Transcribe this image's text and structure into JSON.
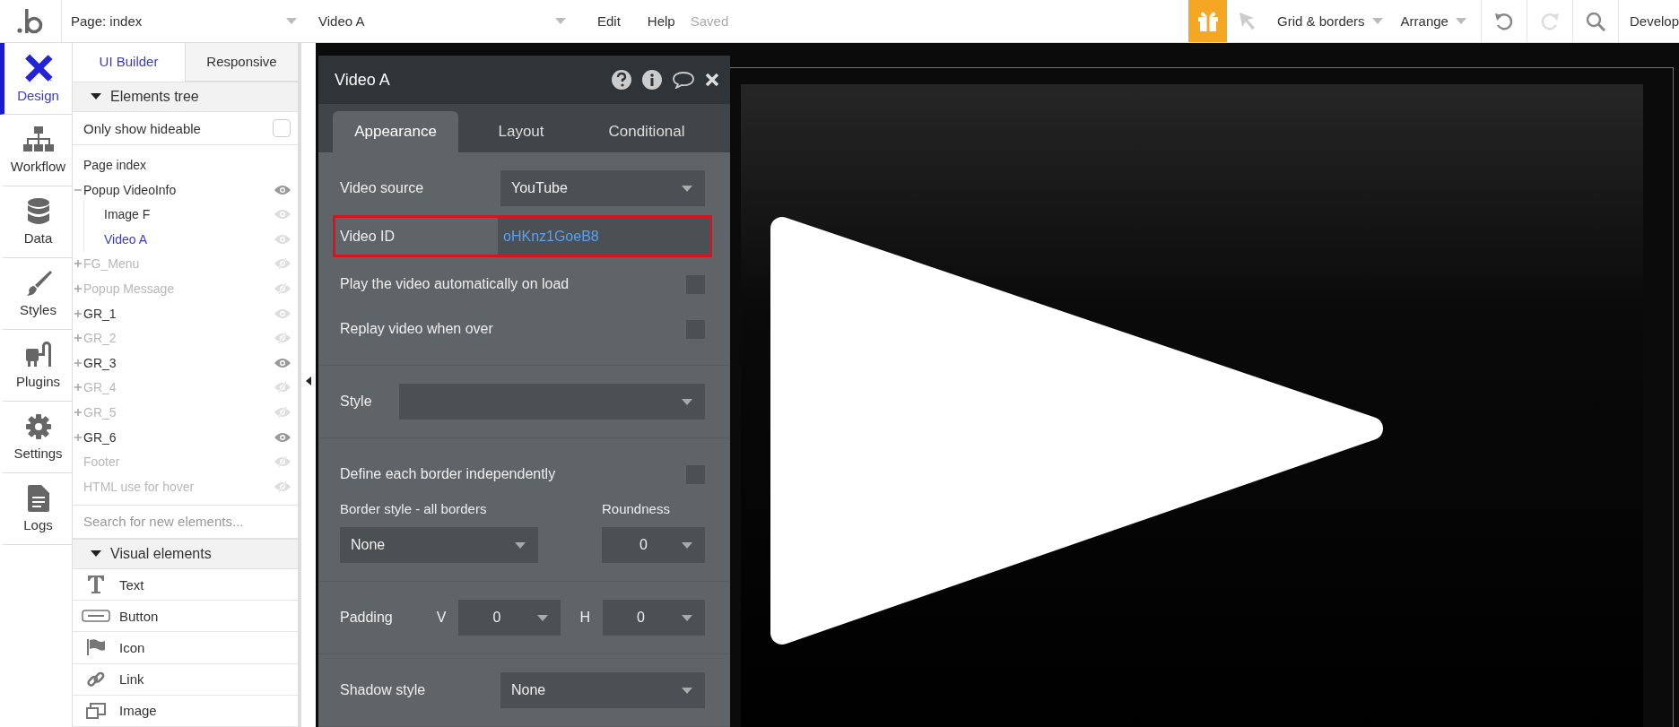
{
  "top_bar": {
    "page_selector": "Page: index",
    "element_selector": "Video A",
    "menu": [
      "Edit",
      "Help"
    ],
    "save_status": "Saved",
    "view_menus": [
      "Grid & borders",
      "Arrange"
    ],
    "history_buttons": [
      {
        "kind": "undo",
        "disabled": false
      },
      {
        "kind": "redo",
        "disabled": true
      }
    ],
    "mode_menu": "Develop"
  },
  "nav": {
    "items": [
      {
        "kind": "design",
        "label": "Design",
        "selected": true
      },
      {
        "kind": "workflow",
        "label": "Workflow",
        "selected": false
      },
      {
        "kind": "data",
        "label": "Data",
        "selected": false
      },
      {
        "kind": "styles",
        "label": "Styles",
        "selected": false
      },
      {
        "kind": "plugins",
        "label": "Plugins",
        "selected": false
      },
      {
        "kind": "settings",
        "label": "Settings",
        "selected": false
      },
      {
        "kind": "logs",
        "label": "Logs",
        "selected": false
      }
    ]
  },
  "sidebar": {
    "tabs": [
      {
        "label": "UI Builder",
        "selected": true
      },
      {
        "label": "Responsive",
        "selected": false
      }
    ],
    "elements_tree": {
      "title": "Elements tree",
      "expanded": true,
      "filter": {
        "label": "Only show hideable",
        "checked": false
      },
      "items": [
        {
          "label": "Page index",
          "selected": false
        },
        {
          "label": "Popup VideoInfo",
          "selected": false,
          "hidden": false,
          "highlighted": true,
          "expanded": true,
          "children": [
            {
              "label": "Image F",
              "selected": false,
              "hidden": false,
              "highlighted": false
            },
            {
              "label": "Video A",
              "selected": true,
              "hidden": false,
              "highlighted": false
            }
          ]
        },
        {
          "label": "FG_Menu",
          "selected": false,
          "hidden": true,
          "highlighted": false,
          "expanded": false
        },
        {
          "label": "Popup Message",
          "selected": false,
          "hidden": true,
          "highlighted": false,
          "expanded": false
        },
        {
          "label": "GR_1",
          "selected": false,
          "hidden": false,
          "highlighted": false,
          "expanded": false
        },
        {
          "label": "GR_2",
          "selected": false,
          "hidden": true,
          "highlighted": false,
          "expanded": false
        },
        {
          "label": "GR_3",
          "selected": false,
          "hidden": false,
          "highlighted": true,
          "expanded": false
        },
        {
          "label": "GR_4",
          "selected": false,
          "hidden": true,
          "highlighted": false,
          "expanded": false
        },
        {
          "label": "GR_5",
          "selected": false,
          "hidden": true,
          "highlighted": false,
          "expanded": false
        },
        {
          "label": "GR_6",
          "selected": false,
          "hidden": false,
          "highlighted": true,
          "expanded": false
        },
        {
          "label": "Footer",
          "selected": false,
          "hidden": true,
          "highlighted": false
        },
        {
          "label": "HTML use for hover",
          "selected": false,
          "hidden": true,
          "highlighted": false
        }
      ]
    },
    "search": {
      "placeholder": "Search for new elements..."
    },
    "visual_elements": {
      "title": "Visual elements",
      "expanded": true,
      "items": [
        {
          "kind": "text",
          "label": "Text"
        },
        {
          "kind": "button",
          "label": "Button"
        },
        {
          "kind": "icon",
          "label": "Icon"
        },
        {
          "kind": "link",
          "label": "Link"
        },
        {
          "kind": "image",
          "label": "Image"
        }
      ]
    }
  },
  "property_panel": {
    "title": "Video A",
    "tabs": [
      {
        "label": "Appearance",
        "selected": true
      },
      {
        "label": "Layout",
        "selected": false
      },
      {
        "label": "Conditional",
        "selected": false
      }
    ],
    "sections": [
      [
        {
          "kind": "dropdown",
          "label": "Video source",
          "value": "YouTube"
        },
        {
          "kind": "input",
          "label": "Video ID",
          "value": "oHKnz1GoeB8",
          "highlighted": true
        },
        {
          "kind": "checkbox",
          "label": "Play the video automatically on load",
          "checked": false
        },
        {
          "kind": "checkbox",
          "label": "Replay video when over",
          "checked": false
        }
      ],
      [
        {
          "kind": "wide_dropdown",
          "label": "Style"
        }
      ],
      [
        {
          "kind": "checkbox",
          "label": "Define each border independently",
          "checked": false
        },
        {
          "kind": "pair",
          "fields": [
            {
              "label": "Border style - all borders",
              "value": "None"
            },
            {
              "label": "Roundness",
              "value": "0"
            }
          ]
        }
      ],
      [
        {
          "kind": "padding",
          "label": "Padding",
          "fields": [
            {
              "label": "V",
              "value": "0"
            },
            {
              "label": "H",
              "value": "0"
            }
          ]
        }
      ],
      [
        {
          "kind": "dropdown",
          "label": "Shadow style",
          "value": "None"
        }
      ]
    ]
  }
}
